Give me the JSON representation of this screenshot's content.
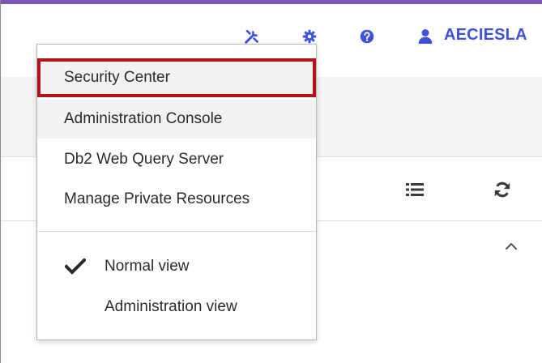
{
  "header": {
    "user_name": "AECIESLA",
    "icons": [
      "tools-icon",
      "gear-icon",
      "help-icon",
      "user-icon"
    ],
    "accent_color": "#3d51e0",
    "top_bar_color": "#7a55b8"
  },
  "toolbar": {
    "icons": [
      "list-icon",
      "refresh-icon",
      "chevron-up-icon"
    ]
  },
  "menu": {
    "items": [
      {
        "label": "Security Center",
        "state": "highlighted"
      },
      {
        "label": "Administration Console",
        "state": "hover"
      },
      {
        "label": "Db2 Web Query Server",
        "state": "normal"
      },
      {
        "label": "Manage Private Resources",
        "state": "normal"
      }
    ],
    "views": [
      {
        "label": "Normal view",
        "checked": true
      },
      {
        "label": "Administration view",
        "checked": false
      }
    ],
    "highlight_color": "#b5121b"
  }
}
